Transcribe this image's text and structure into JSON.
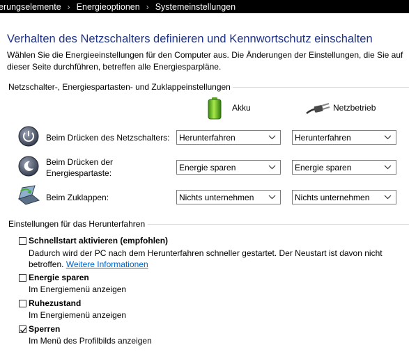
{
  "breadcrumb": {
    "items": [
      "erungselemente",
      "Energieoptionen",
      "Systemeinstellungen"
    ]
  },
  "page": {
    "title": "Verhalten des Netzschalters definieren und Kennwortschutz einschalten",
    "description": "Wählen Sie die Energieeinstellungen für den Computer aus. Die Änderungen der Einstellungen, die Sie auf dieser Seite durchführen, betreffen alle Energiesparpläne."
  },
  "buttons_section": {
    "title": "Netzschalter-, Energiespartasten- und Zuklappeinstellungen",
    "col_battery": "Akku",
    "col_power": "Netzbetrieb",
    "rows": [
      {
        "label": "Beim Drücken des Netzschalters:",
        "battery": "Herunterfahren",
        "power": "Herunterfahren",
        "icon": "power-button-icon"
      },
      {
        "label": "Beim Drücken der Energiespartaste:",
        "battery": "Energie sparen",
        "power": "Energie sparen",
        "icon": "sleep-button-icon"
      },
      {
        "label": "Beim Zuklappen:",
        "battery": "Nichts unternehmen",
        "power": "Nichts unternehmen",
        "icon": "laptop-lid-icon"
      }
    ]
  },
  "shutdown_section": {
    "title": "Einstellungen für das Herunterfahren",
    "options": [
      {
        "title": "Schnellstart aktivieren (empfohlen)",
        "description": "Dadurch wird der PC nach dem Herunterfahren schneller gestartet. Der Neustart ist davon nicht betroffen.",
        "link": "Weitere Informationen",
        "checked": false
      },
      {
        "title": "Energie sparen",
        "description": "Im Energiemenü anzeigen",
        "checked": false
      },
      {
        "title": "Ruhezustand",
        "description": "Im Energiemenü anzeigen",
        "checked": false
      },
      {
        "title": "Sperren",
        "description": "Im Menü des Profilbilds anzeigen",
        "checked": true
      }
    ]
  },
  "colors": {
    "title": "#1e3287",
    "link": "#0066cc",
    "topbar": "#000000"
  }
}
